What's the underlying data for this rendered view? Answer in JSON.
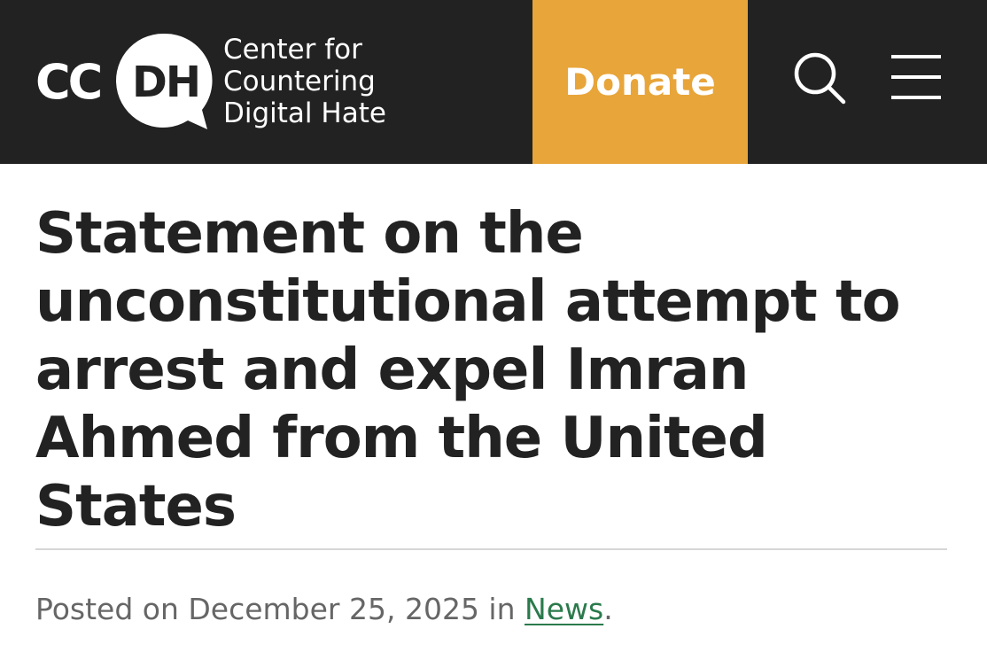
{
  "header": {
    "logo": {
      "mark_left": "CC",
      "mark_bubble": "DH",
      "name": "Center for\nCountering\nDigital Hate"
    },
    "donate_label": "Donate",
    "search_icon": "search-icon",
    "menu_icon": "hamburger-menu-icon"
  },
  "article": {
    "title": "Statement on the unconstitutional attempt to arrest and expel Imran Ahmed from the United States",
    "posted_prefix": "Posted on December 25, 2025 in ",
    "category": "News",
    "posted_suffix": "."
  },
  "colors": {
    "header_bg": "#222222",
    "donate_bg": "#e8a53a",
    "link": "#2a7a4b",
    "meta_text": "#666666"
  }
}
